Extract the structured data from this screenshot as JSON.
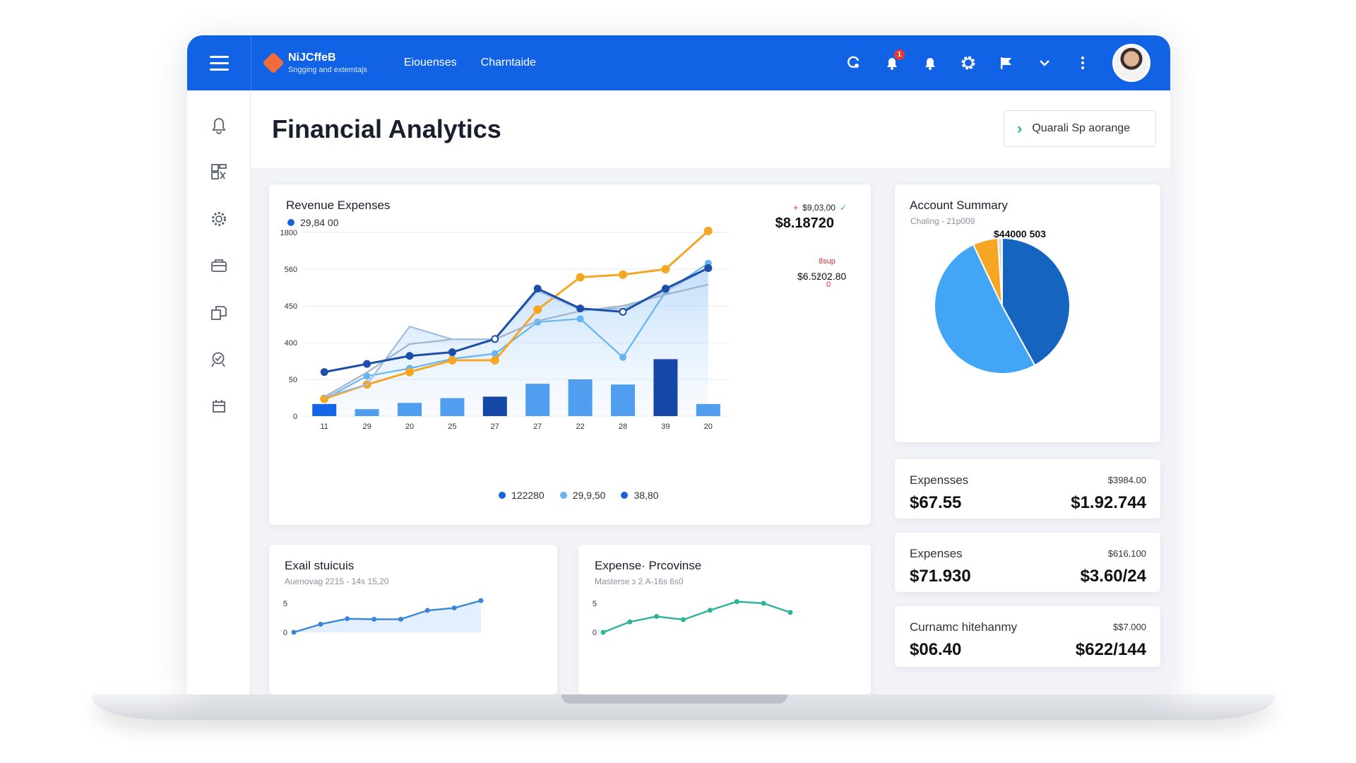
{
  "topbar": {
    "brand_name": "NiJCffeB",
    "brand_sub": "Sngging and extemtajs",
    "nav": [
      "Eiouenses",
      "Charntaide"
    ],
    "notification_count": "1"
  },
  "page": {
    "title_bold": "Financial",
    "title_rest": "Analytics",
    "header_button": "Quarali Sp aorange"
  },
  "main_chart_card": {
    "title": "Revenue  Expenses",
    "legend_value": "29,84 00",
    "top_right_small": "$9,03,00",
    "top_right_big": "$8.18720",
    "callout_small": "8sup",
    "callout_value": "$6.5ž02.80",
    "callout_zero": "0",
    "legend": [
      {
        "label": "122280",
        "color": "#1565d8"
      },
      {
        "label": "29,9,50",
        "color": "#64b5f6"
      },
      {
        "label": "38,80",
        "color": "#1565d8"
      }
    ]
  },
  "chart_data": [
    {
      "type": "bar",
      "title": "Revenue  Expenses",
      "categories": [
        "11",
        "29",
        "20",
        "25",
        "27",
        "27",
        "22",
        "28",
        "39",
        "20"
      ],
      "y_tick_labels": [
        "0",
        "50",
        "400",
        "450",
        "560",
        "1800"
      ],
      "series": [
        {
          "values": [
            0.33,
            0.19,
            0.36,
            0.49,
            0.53,
            0.88,
            1.0,
            0.86,
            1.55,
            0.33
          ]
        },
        {
          "values": [
            0.47,
            1.09,
            1.3,
            1.56,
            1.7,
            2.56,
            2.65,
            1.6,
            3.39,
            4.16
          ]
        },
        {
          "values": [
            0.47,
            0.86,
            1.2,
            1.52,
            1.52,
            2.9,
            3.78,
            3.85,
            4.0,
            5.04
          ]
        },
        {
          "values": [
            0.52,
            1.19,
            1.96,
            2.09,
            2.09,
            2.59,
            2.86,
            3.0,
            3.31,
            3.58
          ]
        },
        {
          "values": [
            0.52,
            0.86,
            2.44,
            2.09,
            2.09,
            3.41,
            2.9,
            2.93,
            3.4,
            4.03
          ]
        },
        {
          "values": [
            1.2,
            1.42,
            1.64,
            1.74,
            2.1,
            3.47,
            2.93,
            2.84,
            3.47,
            4.03
          ]
        }
      ]
    },
    {
      "type": "pie",
      "title": "Account Summary",
      "values": [
        42,
        51,
        6,
        1
      ],
      "colors": [
        "#1565c0",
        "#42a5f5",
        "#f5a623",
        "#d7dbe2"
      ]
    },
    {
      "type": "area",
      "title": "Exail stuicuis",
      "y_tick_labels": [
        "0",
        "5"
      ],
      "values": [
        0.0,
        0.95,
        1.6,
        1.54,
        1.54,
        2.58,
        2.87,
        3.74
      ]
    },
    {
      "type": "line",
      "title": "Expense· Prcovinse",
      "y_tick_labels": [
        "0",
        "5"
      ],
      "values": [
        0.0,
        1.23,
        1.87,
        1.49,
        2.6,
        3.62,
        3.42,
        2.34
      ]
    }
  ],
  "account_summary": {
    "title": "Account Summary",
    "subtitle": "Chaling - 21p009",
    "value": "$44000 503"
  },
  "small_chart_1": {
    "title": "Exail stuicuis",
    "subtitle": "Auenovag 2215 - 14s 15,20"
  },
  "small_chart_2": {
    "title": "Expense· Prcovinse",
    "subtitle": "Masterse з 2 A-16s 6s0"
  },
  "stats": [
    {
      "label": "Expensses",
      "small": "$3984.00",
      "value_left": "$67.55",
      "value_right": "$1.92.744"
    },
    {
      "label": "Expenses",
      "small": "$616.100",
      "value_left": "$71.930",
      "value_right": "$3.60/24"
    },
    {
      "label": "Curnamc hitehanmy",
      "small": "$$7.000",
      "value_left": "$06.40",
      "value_right": "$622/144"
    }
  ],
  "colors": {
    "topbar": "#1262e6",
    "bar_dark": "#1447a6",
    "bar_mid": "#4f9ef0",
    "line_orange": "#f5a623",
    "line_navy": "#1d4fa8",
    "teal": "#2bb39a"
  }
}
